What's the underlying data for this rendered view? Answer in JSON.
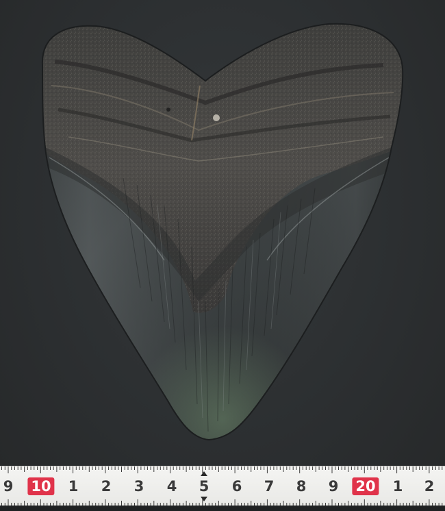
{
  "photo": {
    "subject": "fossil-shark-tooth",
    "background_color": "#2c2f31",
    "tooth_blade_color": "#3b3f40",
    "tooth_root_color": "#4a4845"
  },
  "ruler": {
    "labels": [
      "9",
      "10",
      "1",
      "2",
      "3",
      "4",
      "5",
      "6",
      "7",
      "8",
      "9",
      "20",
      "1",
      "2"
    ],
    "highlight_color": "#e0334a"
  }
}
